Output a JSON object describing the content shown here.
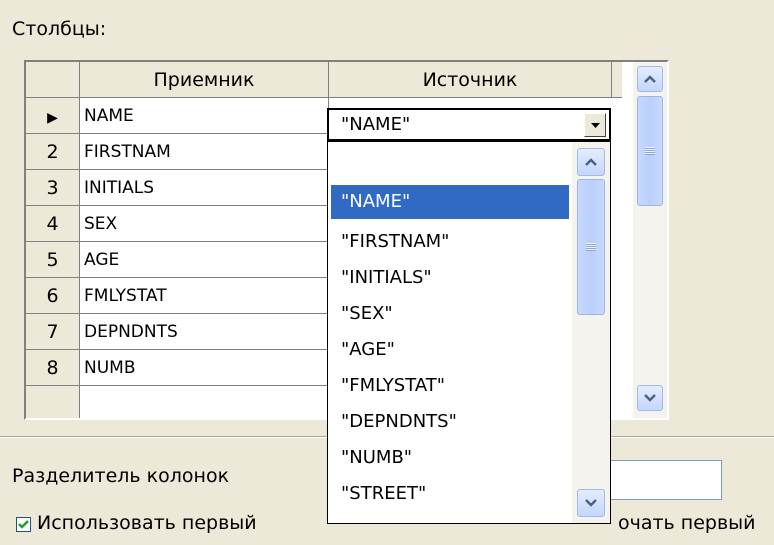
{
  "columns_label": "Столбцы:",
  "grid": {
    "headers": [
      "Приемник",
      "Источник"
    ],
    "current_row_marker": "▶",
    "rows": [
      {
        "num": "",
        "dest": "NAME"
      },
      {
        "num": "2",
        "dest": "FIRSTNAM"
      },
      {
        "num": "3",
        "dest": "INITIALS"
      },
      {
        "num": "4",
        "dest": "SEX"
      },
      {
        "num": "5",
        "dest": "AGE"
      },
      {
        "num": "6",
        "dest": "FMLYSTAT"
      },
      {
        "num": "7",
        "dest": "DEPNDNTS"
      },
      {
        "num": "8",
        "dest": "NUMB"
      }
    ]
  },
  "source_combo": {
    "value": "\"NAME\"",
    "options": [
      "",
      "\"NAME\"",
      "\"FIRSTNAM\"",
      "\"INITIALS\"",
      "\"SEX\"",
      "\"AGE\"",
      "\"FMLYSTAT\"",
      "\"DEPNDNTS\"",
      "\"NUMB\"",
      "\"STREET\""
    ],
    "selected_index": 1
  },
  "separator_label": "Разделитель колонок",
  "use_first_checkbox": {
    "label": "Использовать первый",
    "checked": true
  },
  "right_checkbox_label": "очать первый",
  "colors": {
    "selection": "#316AC5",
    "face": "#ECE9D8"
  }
}
